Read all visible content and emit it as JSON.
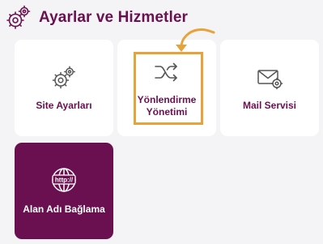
{
  "header": {
    "title": "Ayarlar ve Hizmetler",
    "icon": "gears-icon"
  },
  "tiles": [
    {
      "label": "Site Ayarları",
      "icon": "gears-icon"
    },
    {
      "label_line1": "Yönlendirme",
      "label_line2": "Yönetimi",
      "icon": "shuffle-icon",
      "highlighted": true
    },
    {
      "label": "Mail Servisi",
      "icon": "mail-settings-icon"
    },
    {
      "label": "Alan Adı Bağlama",
      "icon": "http-globe-icon",
      "active": true
    }
  ],
  "colors": {
    "brand": "#6a1050",
    "highlight": "#e7a33a",
    "background": "#f4f4f6",
    "tile": "#ffffff"
  }
}
